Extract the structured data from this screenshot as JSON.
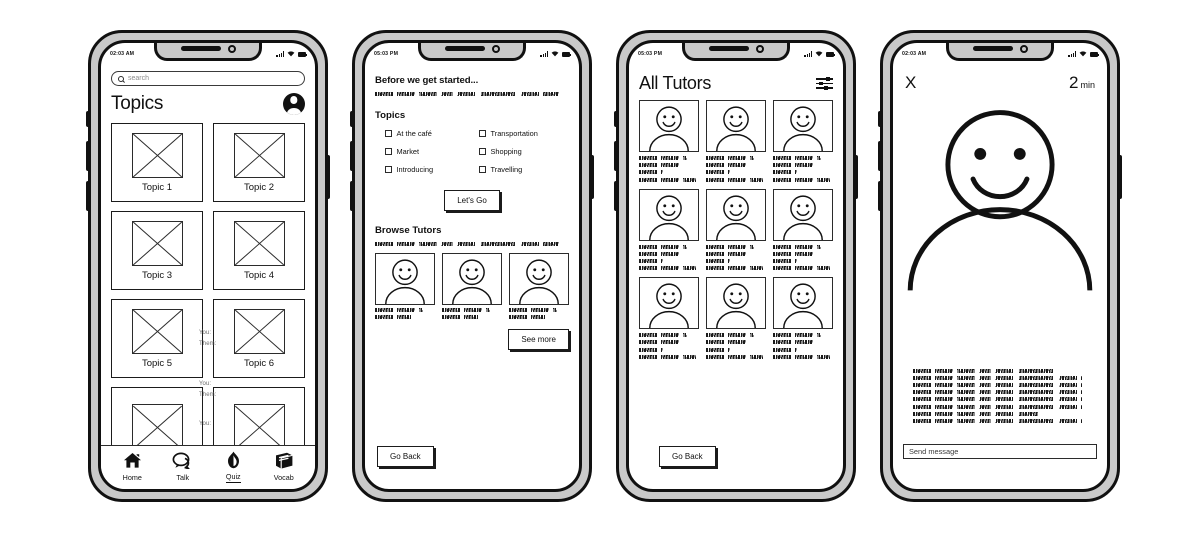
{
  "screens": [
    {
      "id": "topics",
      "statusbar": {
        "time": "02:03 AM",
        "signal_icon": "signal-bars-icon",
        "wifi_icon": "wifi-icon",
        "battery_icon": "battery-icon"
      },
      "search": {
        "placeholder": "search",
        "value": "",
        "icon": "search-icon"
      },
      "title": "Topics",
      "avatar_icon": "profile-avatar-icon",
      "topics": [
        {
          "label": "Topic 1"
        },
        {
          "label": "Topic 2"
        },
        {
          "label": "Topic 3"
        },
        {
          "label": "Topic 4"
        },
        {
          "label": "Topic 5"
        },
        {
          "label": "Topic 6"
        }
      ],
      "ghost_labels": [
        "You:",
        "Them:",
        "You:",
        "Them:",
        "You:"
      ],
      "tabbar": [
        {
          "label": "Home",
          "icon": "home-icon",
          "active": false
        },
        {
          "label": "Talk",
          "icon": "chat-bubble-icon",
          "active": false
        },
        {
          "label": "Quiz",
          "icon": "flame-icon",
          "active": true
        },
        {
          "label": "Vocab",
          "icon": "book-icon",
          "active": false
        }
      ]
    },
    {
      "id": "onboarding",
      "statusbar": {
        "time": "05:03 PM"
      },
      "title": "Before we get started...",
      "topics_heading": "Topics",
      "checkboxes": [
        {
          "label": "At the café",
          "checked": false
        },
        {
          "label": "Transportation",
          "checked": false
        },
        {
          "label": "Market",
          "checked": false
        },
        {
          "label": "Shopping",
          "checked": false
        },
        {
          "label": "Introducing",
          "checked": false
        },
        {
          "label": "Travelling",
          "checked": false
        }
      ],
      "primary_button": "Let's Go",
      "browse_heading": "Browse Tutors",
      "see_more_button": "See more",
      "go_back_button": "Go Back",
      "tutor_count": 3
    },
    {
      "id": "all-tutors",
      "statusbar": {
        "time": "05:03 PM"
      },
      "title": "All Tutors",
      "filter_icon": "filter-sliders-icon",
      "tutor_count": 9,
      "go_back_button": "Go Back"
    },
    {
      "id": "chat",
      "statusbar": {
        "time": "02:03 AM"
      },
      "close_label": "X",
      "timer_value": "2",
      "timer_unit": "min",
      "avatar_icon": "large-smiley-avatar",
      "message_lines": 8,
      "send_input": {
        "placeholder": "Send message",
        "value": ""
      }
    }
  ],
  "theme": {
    "ink": "#111111",
    "bezel": "#c9c9c9",
    "screen_bg": "#ffffff",
    "placeholder": "#8c8c8c"
  }
}
